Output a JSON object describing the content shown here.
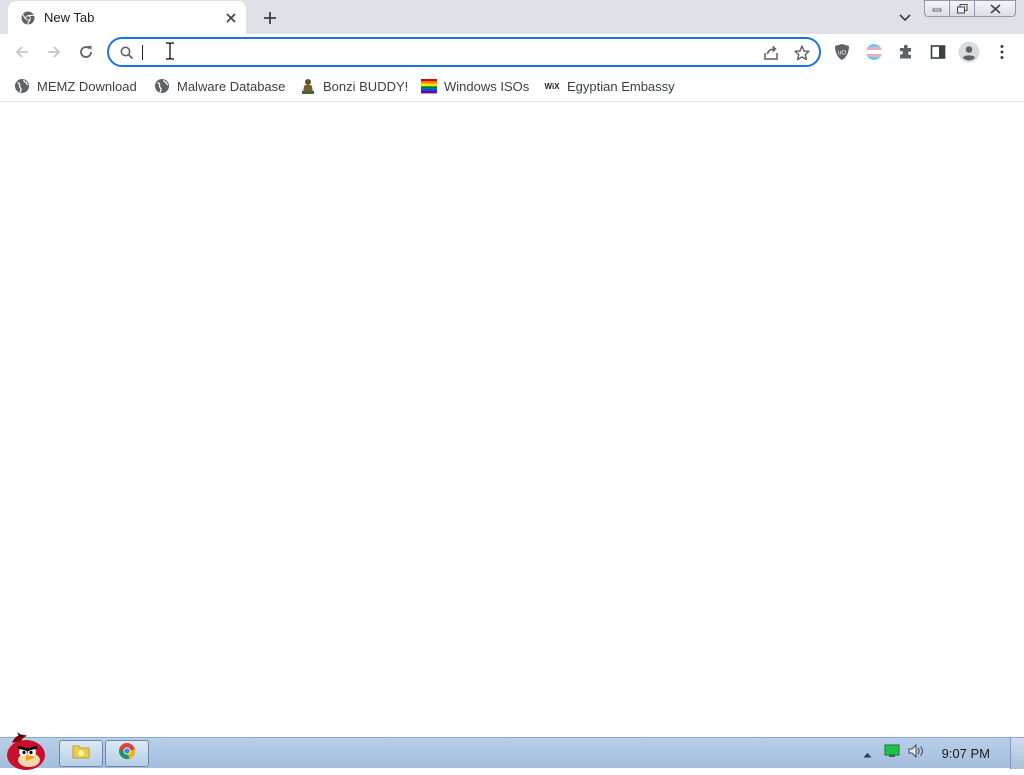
{
  "tab": {
    "title": "New Tab"
  },
  "omnibox": {
    "value": ""
  },
  "bookmarks": [
    {
      "label": "MEMZ Download",
      "icon": "globe-icon"
    },
    {
      "label": "Malware Database",
      "icon": "globe-icon"
    },
    {
      "label": "Bonzi BUDDY!",
      "icon": "bonzi-icon"
    },
    {
      "label": "Windows ISOs",
      "icon": "rainbow-flag-icon"
    },
    {
      "label": "Egyptian Embassy",
      "icon": "wix-icon"
    }
  ],
  "taskbar": {
    "clock": "9:07 PM"
  },
  "colors": {
    "accent": "#1a73e8",
    "tabstrip": "#dee1e6",
    "taskbar": "#b9cfe8"
  }
}
